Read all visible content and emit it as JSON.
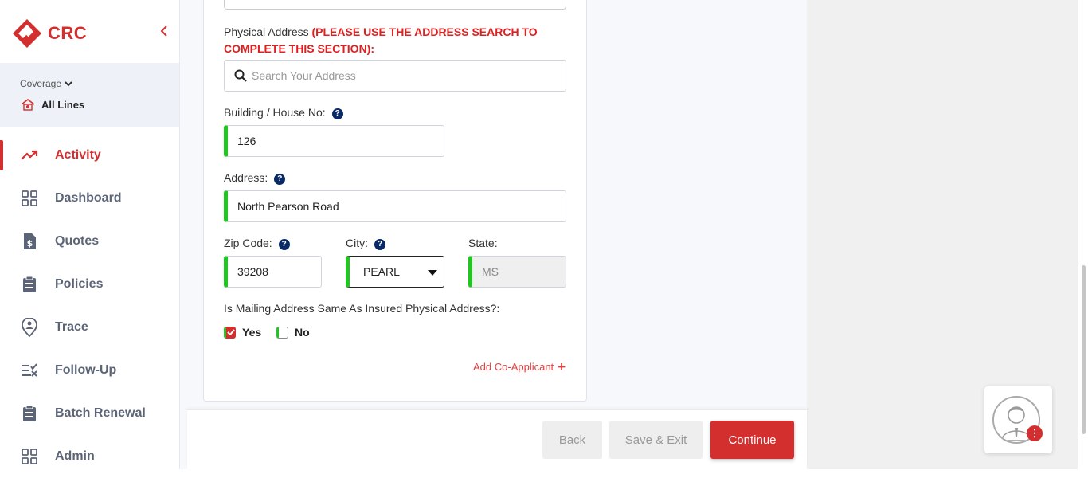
{
  "brand": {
    "name": "CRC",
    "color": "#d32f2f"
  },
  "sidebar": {
    "coverage_label": "Coverage",
    "coverage_value": "All Lines",
    "items": [
      {
        "label": "Activity",
        "icon": "trend-up-icon",
        "active": true
      },
      {
        "label": "Dashboard",
        "icon": "grid-icon"
      },
      {
        "label": "Quotes",
        "icon": "dollar-doc-icon"
      },
      {
        "label": "Policies",
        "icon": "clipboard-icon"
      },
      {
        "label": "Trace",
        "icon": "location-user-icon"
      },
      {
        "label": "Follow-Up",
        "icon": "list-check-icon"
      },
      {
        "label": "Batch Renewal",
        "icon": "clipboard-icon"
      },
      {
        "label": "Admin",
        "icon": "grid-icon"
      }
    ]
  },
  "form": {
    "physical_address_label": "Physical Address",
    "physical_address_warning": "(PLEASE USE THE ADDRESS SEARCH TO COMPLETE THIS SECTION):",
    "search_placeholder": "Search Your Address",
    "building_label": "Building / House No:",
    "building_value": "126",
    "address_label": "Address:",
    "address_value": "North Pearson Road",
    "zip_label": "Zip Code:",
    "zip_value": "39208",
    "city_label": "City:",
    "city_value": "PEARL",
    "state_label": "State:",
    "state_value": "MS",
    "mailing_question": "Is Mailing Address Same As Insured Physical Address?:",
    "yes_label": "Yes",
    "no_label": "No",
    "yes_checked": true,
    "no_checked": false,
    "add_co_applicant": "Add Co-Applicant",
    "help_glyph": "?"
  },
  "footer": {
    "back_label": "Back",
    "save_exit_label": "Save & Exit",
    "continue_label": "Continue"
  },
  "chat": {
    "badge": "⋮"
  },
  "colors": {
    "accent": "#d32f2f",
    "valid": "#22c522",
    "help": "#0a2a66"
  }
}
